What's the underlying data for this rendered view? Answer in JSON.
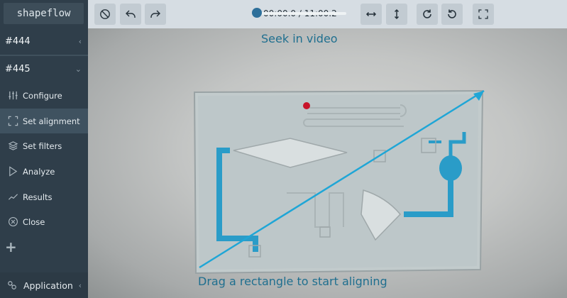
{
  "app": {
    "logo": "shapeflow"
  },
  "sidebar": {
    "groups": [
      {
        "label": "#444",
        "chevron": "‹"
      },
      {
        "label": "#445",
        "chevron": "⌄"
      }
    ],
    "items": [
      {
        "label": "Configure",
        "icon": "sliders-icon"
      },
      {
        "label": "Set alignment",
        "icon": "crop-icon",
        "active": true
      },
      {
        "label": "Set filters",
        "icon": "layers-icon"
      },
      {
        "label": "Analyze",
        "icon": "play-icon"
      },
      {
        "label": "Results",
        "icon": "chart-line-icon"
      },
      {
        "label": "Close",
        "icon": "close-circle-icon"
      }
    ],
    "add": "+",
    "application": {
      "label": "Application",
      "chevron": "‹",
      "icon": "link-icon"
    }
  },
  "toolbar": {
    "time": "00:00.0 / 11:00.2",
    "seek_progress": 0.0,
    "buttons": [
      "cancel-icon",
      "undo-icon",
      "redo-icon",
      "flip-horizontal-icon",
      "flip-vertical-icon",
      "rotate-cw-icon",
      "rotate-ccw-icon",
      "fullscreen-icon"
    ]
  },
  "video": {
    "hint_top": "Seek in video",
    "hint_bottom": "Drag a rectangle to start aligning"
  },
  "colors": {
    "accent": "#1fa6d6",
    "channel": "#2a9cc8",
    "sidebar": "#2f3e4a",
    "toolbar": "#d6dde3"
  }
}
